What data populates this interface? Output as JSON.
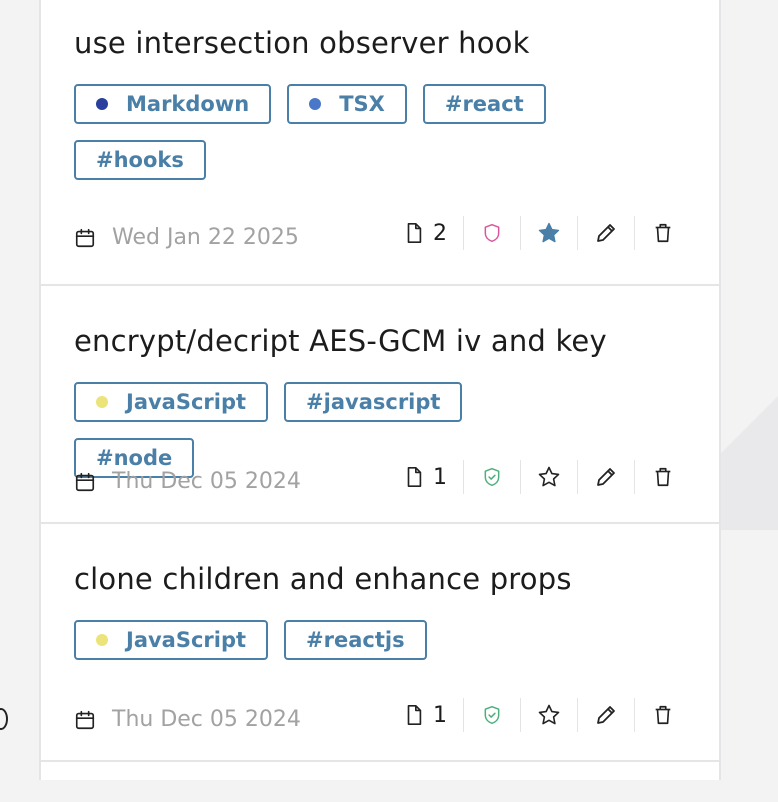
{
  "snippets": [
    {
      "title": "use intersection observer hook",
      "tags": [
        {
          "label": "Markdown",
          "dot_color": "#2a3f9e"
        },
        {
          "label": "TSX",
          "dot_color": "#4a78c8"
        },
        {
          "label": "#react"
        },
        {
          "label": "#hooks"
        }
      ],
      "date": "Wed Jan 22 2025",
      "file_count": "2",
      "visibility": "private",
      "visibility_color": "#d9569b",
      "starred": true,
      "star_color": "#4a7fa7"
    },
    {
      "title": "encrypt/decript AES-GCM iv and key",
      "tags": [
        {
          "label": "JavaScript",
          "dot_color": "#ece37a"
        },
        {
          "label": "#javascript"
        },
        {
          "label": "#node"
        }
      ],
      "date": "Thu Dec 05 2024",
      "file_count": "1",
      "visibility": "public",
      "visibility_color": "#4caf7d",
      "starred": false,
      "star_color": "#222222"
    },
    {
      "title": "clone children and enhance props",
      "tags": [
        {
          "label": "JavaScript",
          "dot_color": "#ece37a"
        },
        {
          "label": "#reactjs"
        }
      ],
      "date": "Thu Dec 05 2024",
      "file_count": "1",
      "visibility": "public",
      "visibility_color": "#4caf7d",
      "starred": false,
      "star_color": "#222222"
    }
  ],
  "icons": {
    "calendar": "calendar-icon",
    "file": "file-icon",
    "shield": "shield-icon",
    "star": "star-icon",
    "edit": "pencil-icon",
    "delete": "trash-icon"
  }
}
